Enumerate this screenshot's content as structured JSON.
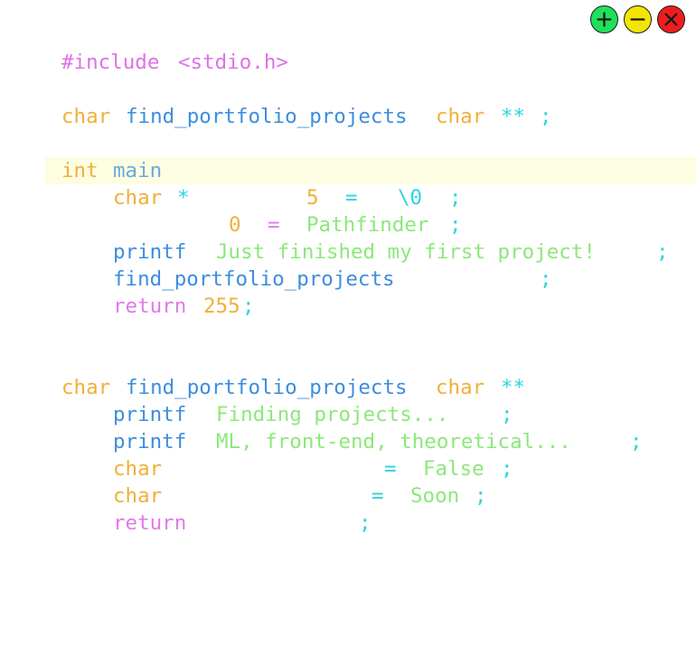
{
  "window_controls": {
    "add_icon": "plus-icon",
    "minimize_icon": "minus-icon",
    "close_icon": "close-icon",
    "colors": {
      "green": "#1fe05b",
      "yellow": "#f2e600",
      "red": "#ef1d1d"
    }
  },
  "code": {
    "include": {
      "directive": "#include",
      "header": "<stdio.h>"
    },
    "prototype": {
      "type": "char",
      "name": "find_portfolio_projects",
      "param_type": "char",
      "stars": "**",
      "semicolon": ";"
    },
    "main": {
      "type": "int",
      "name": "main",
      "line1": {
        "type": "char",
        "star": "*",
        "size": "5",
        "eq": "=",
        "value": "\\0",
        "semi": ";"
      },
      "line2": {
        "index": "0",
        "eq": "=",
        "value": "Pathfinder",
        "semi": ";"
      },
      "line3": {
        "fn": "printf",
        "text": "Just finished my first project!",
        "semi": ";"
      },
      "line4": {
        "fn": "find_portfolio_projects",
        "semi": ";"
      },
      "line5": {
        "keyword": "return",
        "value": "255",
        "semi": ";"
      }
    },
    "definition": {
      "type": "char",
      "name": "find_portfolio_projects",
      "param_type": "char",
      "stars": "**",
      "line1": {
        "fn": "printf",
        "text": "Finding projects...",
        "semi": ";"
      },
      "line2": {
        "fn": "printf",
        "text": "ML, front-end, theoretical...",
        "semi": ";"
      },
      "line3": {
        "type": "char",
        "eq": "=",
        "value": "False",
        "semi": ";"
      },
      "line4": {
        "type": "char",
        "eq": "=",
        "value": "Soon",
        "semi": ";"
      },
      "line5": {
        "keyword": "return",
        "semi": ";"
      }
    },
    "colors": {
      "preprocessor": "#e070e8",
      "type": "#f0b03a",
      "function": "#3c8de0",
      "operator": "#2ed3dd",
      "string": "#8ce87a",
      "keyword": "#e07ae8",
      "highlight_line": "#fdfde1"
    }
  }
}
